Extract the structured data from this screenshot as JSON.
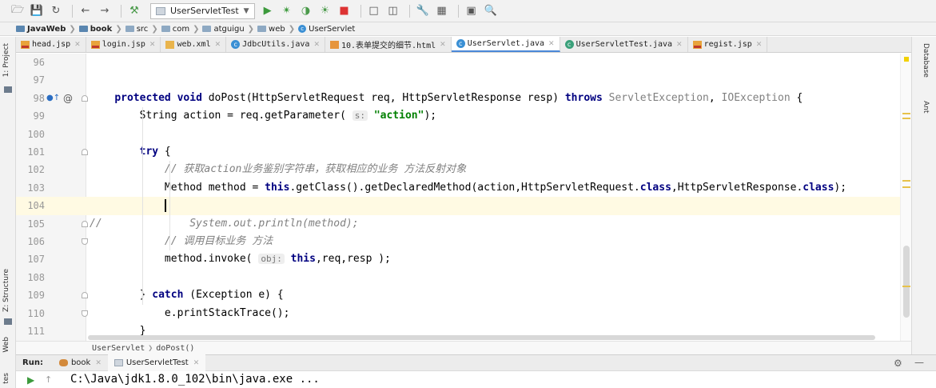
{
  "toolbar": {
    "run_config": "UserServletTest",
    "icons": [
      "folder-open-icon",
      "save-icon",
      "sync-icon",
      "back-icon",
      "forward-icon",
      "build-hammer-icon",
      "run-icon",
      "debug-icon",
      "coverage-icon",
      "profile-icon",
      "stop-icon",
      "frame-icon",
      "frame2-icon",
      "wrench-icon",
      "project-structure-icon",
      "terminal-icon",
      "search-icon"
    ]
  },
  "nav": {
    "crumbs": [
      "JavaWeb",
      "book",
      "src",
      "com",
      "atguigu",
      "web",
      "UserServlet"
    ]
  },
  "left_strip": {
    "project": "1: Project",
    "structure": "Z: Structure",
    "web": "Web",
    "favorites": "tes"
  },
  "right_strip": {
    "database": "Database",
    "ant": "Ant"
  },
  "tabs": [
    {
      "label": "head.jsp",
      "icon": "jsp"
    },
    {
      "label": "login.jsp",
      "icon": "jsp"
    },
    {
      "label": "web.xml",
      "icon": "xml"
    },
    {
      "label": "JdbcUtils.java",
      "icon": "class"
    },
    {
      "label": "10.表单提交的细节.html",
      "icon": "html"
    },
    {
      "label": "UserServlet.java",
      "icon": "class",
      "active": true
    },
    {
      "label": "UserServletTest.java",
      "icon": "test"
    },
    {
      "label": "regist.jsp",
      "icon": "jsp"
    }
  ],
  "editor": {
    "lines": [
      {
        "n": "96",
        "parts": []
      },
      {
        "n": "97",
        "parts": []
      },
      {
        "n": "98",
        "parts": [
          {
            "t": "    "
          },
          {
            "t": "protected",
            "c": "kw"
          },
          {
            "t": " "
          },
          {
            "t": "void",
            "c": "kw"
          },
          {
            "t": " doPost(HttpServletRequest req, HttpServletResponse resp) "
          },
          {
            "t": "throws",
            "c": "kw"
          },
          {
            "t": " "
          },
          {
            "t": "ServletException",
            "c": "gray"
          },
          {
            "t": ", "
          },
          {
            "t": "IOException",
            "c": "gray"
          },
          {
            "t": " {"
          }
        ]
      },
      {
        "n": "99",
        "parts": [
          {
            "t": "        String action = req.getParameter( "
          },
          {
            "t": "s:",
            "c": "hint"
          },
          {
            "t": " "
          },
          {
            "t": "\"action\"",
            "c": "str"
          },
          {
            "t": ");"
          }
        ]
      },
      {
        "n": "100",
        "parts": []
      },
      {
        "n": "101",
        "parts": [
          {
            "t": "        "
          },
          {
            "t": "try",
            "c": "kw"
          },
          {
            "t": " {"
          }
        ]
      },
      {
        "n": "102",
        "parts": [
          {
            "t": "            "
          },
          {
            "t": "// 获取action业务鉴别字符串，获取相应的业务 方法反射对象",
            "c": "cmt"
          }
        ]
      },
      {
        "n": "103",
        "parts": [
          {
            "t": "            Method method = "
          },
          {
            "t": "this",
            "c": "kw"
          },
          {
            "t": ".getClass().getDeclaredMethod(action,HttpServletRequest."
          },
          {
            "t": "class",
            "c": "kw"
          },
          {
            "t": ",HttpServletResponse."
          },
          {
            "t": "class",
            "c": "kw"
          },
          {
            "t": ");"
          }
        ]
      },
      {
        "n": "104",
        "parts": [
          {
            "t": "            "
          },
          {
            "t": "",
            "c": "caret"
          }
        ],
        "current": true
      },
      {
        "n": "105",
        "parts": [
          {
            "t": "//",
            "c": "cmt"
          },
          {
            "t": "              System.out.println(method);",
            "c": "cmt"
          }
        ]
      },
      {
        "n": "106",
        "parts": [
          {
            "t": "            "
          },
          {
            "t": "// 调用目标业务 方法",
            "c": "cmt"
          }
        ]
      },
      {
        "n": "107",
        "parts": [
          {
            "t": "            method.invoke( "
          },
          {
            "t": "obj:",
            "c": "hint"
          },
          {
            "t": " "
          },
          {
            "t": "this",
            "c": "kw"
          },
          {
            "t": ",req,resp );"
          }
        ]
      },
      {
        "n": "108",
        "parts": []
      },
      {
        "n": "109",
        "parts": [
          {
            "t": "        } "
          },
          {
            "t": "catch",
            "c": "kw"
          },
          {
            "t": " (Exception e) {"
          }
        ]
      },
      {
        "n": "110",
        "parts": [
          {
            "t": "            e.printStackTrace();"
          }
        ]
      },
      {
        "n": "111",
        "parts": [
          {
            "t": "        }"
          }
        ]
      }
    ]
  },
  "editor_crumb": {
    "cls": "UserServlet",
    "method": "doPost()"
  },
  "run": {
    "label": "Run:",
    "tabs": [
      "book",
      "UserServletTest"
    ],
    "output": "C:\\Java\\jdk1.8.0_102\\bin\\java.exe ..."
  }
}
